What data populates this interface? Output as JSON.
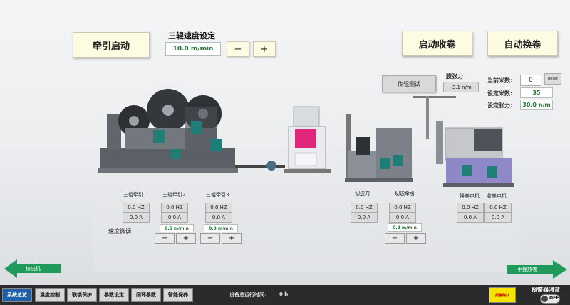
{
  "top": {
    "traction_start": "牵引启动",
    "roller_speed_title": "三辊速度设定",
    "roller_speed_value": "10.0 m/min",
    "minus": "−",
    "plus": "+",
    "start_winding": "启动收卷",
    "auto_change": "自动换卷"
  },
  "tension_panel": {
    "test_button": "传辊测试",
    "film_tension_label": "膜张力",
    "film_tension_value": "-3.1 n/m",
    "current_meter_label": "当前米数:",
    "current_meter_value": "0",
    "reset_label": "Reset",
    "set_meter_label": "设定米数:",
    "set_meter_value": "35",
    "set_tension_label": "设定张力:",
    "set_tension_value": "30.0 n/m"
  },
  "motors": [
    {
      "label": "三辊牵引1",
      "hz": "0.0 HZ",
      "amp": "0.0 A"
    },
    {
      "label": "三辊牵引2",
      "hz": "0.0 HZ",
      "amp": "0.0 A",
      "speed": "0.5 m/min"
    },
    {
      "label": "三辊牵引3",
      "hz": "0.0 HZ",
      "amp": "0.0 A",
      "speed": "0.3 m/min"
    },
    {
      "label": "切边刀",
      "hz": "0.0 HZ",
      "amp": "0.0 A"
    },
    {
      "label": "切边牵引",
      "hz": "0.0 HZ",
      "amp": "0.0 A",
      "speed": "0.2 m/min"
    },
    {
      "label": "换卷电机",
      "hz": "0.0 HZ",
      "amp": "0.0 A"
    },
    {
      "label": "收卷电机",
      "hz": "0.0 HZ",
      "amp": "0.0 A"
    }
  ],
  "speed_fine_tune": "速度微调",
  "arrows": {
    "left": "挤出机",
    "right": "手摇放卷"
  },
  "nav": {
    "items": [
      "系统总览",
      "温度控制",
      "联锁保护",
      "参数设定",
      "闭环参数",
      "智能保养"
    ],
    "runtime_label": "设备总运行时间:",
    "runtime_value": "0 h",
    "alarm_confirm": "报警确认",
    "alarm_mute": "报警器消音",
    "toggle": "OFF"
  }
}
